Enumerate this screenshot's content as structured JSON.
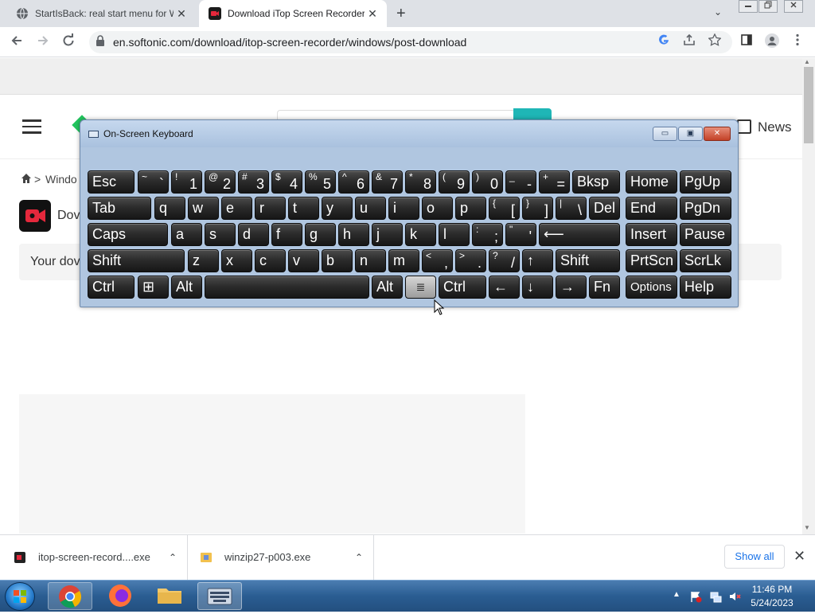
{
  "browser": {
    "tabs": [
      {
        "title": "StartIsBack: real start menu for W",
        "active": false
      },
      {
        "title": "Download iTop Screen Recorder",
        "active": true
      }
    ],
    "new_tab_symbol": "+",
    "tab_close_symbol": "✕",
    "tab_search_symbol": "⌄",
    "url": "en.softonic.com/download/itop-screen-recorder/windows/post-download"
  },
  "page": {
    "nav_news": "News",
    "breadcrumb": {
      "separator": ">",
      "item": "Windo"
    },
    "download_title": "Dov",
    "your_download": "Your dov"
  },
  "osk": {
    "title": "On-Screen Keyboard",
    "min_symbol": "▭",
    "max_symbol": "▣",
    "close_symbol": "✕",
    "keys": {
      "esc": "Esc",
      "tilde_up": "~",
      "tilde_dn": "`",
      "n1_up": "!",
      "n1": "1",
      "n2_up": "@",
      "n2": "2",
      "n3_up": "#",
      "n3": "3",
      "n4_up": "$",
      "n4": "4",
      "n5_up": "%",
      "n5": "5",
      "n6_up": "^",
      "n6": "6",
      "n7_up": "&",
      "n7": "7",
      "n8_up": "*",
      "n8": "8",
      "n9_up": "(",
      "n9": "9",
      "n0_up": ")",
      "n0": "0",
      "minus_up": "_",
      "minus": "-",
      "eq_up": "+",
      "eq": "=",
      "bksp": "Bksp",
      "home": "Home",
      "pgup": "PgUp",
      "tab": "Tab",
      "q": "q",
      "w": "w",
      "e": "e",
      "r": "r",
      "t": "t",
      "y": "y",
      "u": "u",
      "i": "i",
      "o": "o",
      "p": "p",
      "lbr_up": "{",
      "lbr": "[",
      "rbr_up": "}",
      "rbr": "]",
      "bsl_up": "|",
      "bsl": "\\",
      "del": "Del",
      "end": "End",
      "pgdn": "PgDn",
      "caps": "Caps",
      "a": "a",
      "s": "s",
      "d": "d",
      "f": "f",
      "g": "g",
      "h": "h",
      "j": "j",
      "k": "k",
      "l": "l",
      "semi_up": ":",
      "semi": ";",
      "quote_up": "\"",
      "quote": "'",
      "enter": "⟵",
      "insert": "Insert",
      "pause": "Pause",
      "shift": "Shift",
      "z": "z",
      "x": "x",
      "c": "c",
      "v": "v",
      "b": "b",
      "n": "n",
      "m": "m",
      "comma_up": "<",
      "comma": ",",
      "period_up": ">",
      "period": ".",
      "slash_up": "?",
      "slash": "/",
      "up": "↑",
      "rshift": "Shift",
      "prtscn": "PrtScn",
      "scrlk": "ScrLk",
      "ctrl": "Ctrl",
      "win": "⊞",
      "alt": "Alt",
      "ralt": "Alt",
      "menu": "≣",
      "rctrl": "Ctrl",
      "left": "←",
      "down": "↓",
      "right": "→",
      "fn": "Fn",
      "options": "Options",
      "help": "Help"
    }
  },
  "downloads": {
    "items": [
      {
        "name": "itop-screen-record....exe",
        "chevron": "⌃"
      },
      {
        "name": "winzip27-p003.exe",
        "chevron": "⌃"
      }
    ],
    "show_all": "Show all",
    "close_symbol": "✕"
  },
  "taskbar": {
    "tray_arrow": "▲",
    "time": "11:46 PM",
    "date": "5/24/2023"
  }
}
